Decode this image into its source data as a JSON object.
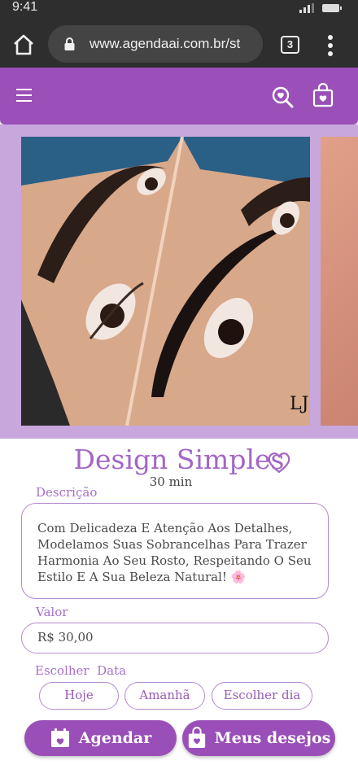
{
  "status_bar": {
    "time": "9:41"
  },
  "browser": {
    "url": "www.agendaai.com.br/st",
    "tab_count": "3"
  },
  "gallery": {
    "watermark": "LJ"
  },
  "service": {
    "title": "Design Simples",
    "duration": "30 min",
    "description_label": "Descrição",
    "description": "Com Delicadeza E Atenção Aos Detalhes, Modelamos Suas Sobrancelhas Para Trazer Harmonia Ao Seu Rosto, Respeitando O Seu Estilo E A Sua Beleza Natural! 🌸",
    "value_label": "Valor",
    "value": "R$ 30,00"
  },
  "date_picker": {
    "label": "Escolher  Data",
    "options": [
      "Hoje",
      "Amanhã",
      "Escolher dia"
    ]
  },
  "actions": {
    "schedule": "Agendar",
    "wishlist": "Meus desejos"
  },
  "colors": {
    "primary": "#9a4fb8",
    "gallery_bg": "#c8a7dd",
    "title": "#a466c6"
  },
  "icons": [
    "home-icon",
    "lock-icon",
    "tabs-icon",
    "more-vert-icon",
    "menu-icon",
    "search-heart-icon",
    "shopping-bag-heart-icon",
    "heart-outline-icon",
    "calendar-icon"
  ]
}
